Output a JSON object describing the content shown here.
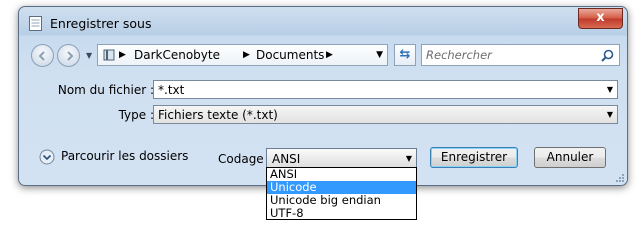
{
  "window": {
    "title": "Enregistrer sous",
    "close_glyph": "x"
  },
  "navigation": {
    "back_icon": "back-arrow-icon",
    "forward_icon": "forward-arrow-icon",
    "breadcrumbs": [
      "DarkCenobyte",
      "Documents"
    ],
    "refresh_icon": "refresh-icon",
    "search_placeholder": "Rechercher"
  },
  "form": {
    "filename_label": "Nom du fichier :",
    "filename_value": "*.txt",
    "type_label": "Type :",
    "type_value": "Fichiers texte (*.txt)"
  },
  "footer": {
    "browse_label": "Parcourir les dossiers",
    "encoding_label": "Codage :",
    "encoding_value": "ANSI",
    "save_label": "Enregistrer",
    "cancel_label": "Annuler"
  },
  "encoding_options": [
    "ANSI",
    "Unicode",
    "Unicode big endian",
    "UTF-8"
  ],
  "encoding_highlighted": "Unicode",
  "colors": {
    "selection": "#3399ff",
    "close_button": "#c0392b"
  }
}
